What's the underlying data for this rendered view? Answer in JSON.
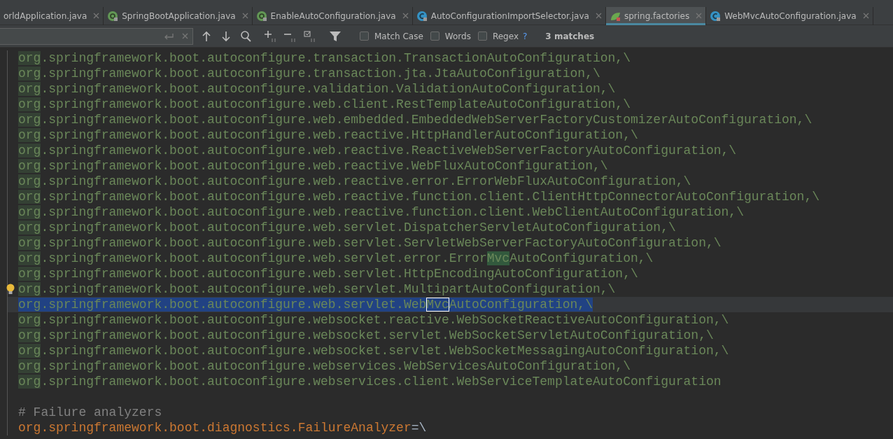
{
  "tabs": [
    {
      "label": "orldApplication.java",
      "kind": "plain",
      "selected": false
    },
    {
      "label": "SpringBootApplication.java",
      "kind": "annotation",
      "selected": false
    },
    {
      "label": "EnableAutoConfiguration.java",
      "kind": "annotation",
      "selected": false
    },
    {
      "label": "AutoConfigurationImportSelector.java",
      "kind": "class",
      "selected": false
    },
    {
      "label": "spring.factories",
      "kind": "factories",
      "selected": true
    },
    {
      "label": "WebMvcAutoConfiguration.java",
      "kind": "class",
      "selected": false
    }
  ],
  "search": {
    "match_case": {
      "label": "Match Case",
      "checked": false
    },
    "words": {
      "label": "Words",
      "checked": false
    },
    "regex": {
      "label": "Regex",
      "checked": false
    },
    "help": "?",
    "result": "3 matches"
  },
  "lines": [
    {
      "bulb": false,
      "selected": false,
      "segments": [
        {
          "kind": "org",
          "text": "org"
        },
        {
          "kind": "value",
          "text": ".springframework.boot.autoconfigure.transaction.TransactionAutoConfiguration,\\"
        }
      ]
    },
    {
      "bulb": false,
      "selected": false,
      "segments": [
        {
          "kind": "org",
          "text": "org"
        },
        {
          "kind": "value",
          "text": ".springframework.boot.autoconfigure.transaction.jta.JtaAutoConfiguration,\\"
        }
      ]
    },
    {
      "bulb": false,
      "selected": false,
      "segments": [
        {
          "kind": "org",
          "text": "org"
        },
        {
          "kind": "value",
          "text": ".springframework.boot.autoconfigure.validation.ValidationAutoConfiguration,\\"
        }
      ]
    },
    {
      "bulb": false,
      "selected": false,
      "segments": [
        {
          "kind": "org",
          "text": "org"
        },
        {
          "kind": "value",
          "text": ".springframework.boot.autoconfigure.web.client.RestTemplateAutoConfiguration,\\"
        }
      ]
    },
    {
      "bulb": false,
      "selected": false,
      "segments": [
        {
          "kind": "org",
          "text": "org"
        },
        {
          "kind": "value",
          "text": ".springframework.boot.autoconfigure.web.embedded.EmbeddedWebServerFactoryCustomizerAutoConfiguration,\\"
        }
      ]
    },
    {
      "bulb": false,
      "selected": false,
      "segments": [
        {
          "kind": "org",
          "text": "org"
        },
        {
          "kind": "value",
          "text": ".springframework.boot.autoconfigure.web.reactive.HttpHandlerAutoConfiguration,\\"
        }
      ]
    },
    {
      "bulb": false,
      "selected": false,
      "segments": [
        {
          "kind": "org",
          "text": "org"
        },
        {
          "kind": "value",
          "text": ".springframework.boot.autoconfigure.web.reactive.ReactiveWebServerFactoryAutoConfiguration,\\"
        }
      ]
    },
    {
      "bulb": false,
      "selected": false,
      "segments": [
        {
          "kind": "org",
          "text": "org"
        },
        {
          "kind": "value",
          "text": ".springframework.boot.autoconfigure.web.reactive.WebFluxAutoConfiguration,\\"
        }
      ]
    },
    {
      "bulb": false,
      "selected": false,
      "segments": [
        {
          "kind": "org",
          "text": "org"
        },
        {
          "kind": "value",
          "text": ".springframework.boot.autoconfigure.web.reactive.error.ErrorWebFluxAutoConfiguration,\\"
        }
      ]
    },
    {
      "bulb": false,
      "selected": false,
      "segments": [
        {
          "kind": "org",
          "text": "org"
        },
        {
          "kind": "value",
          "text": ".springframework.boot.autoconfigure.web.reactive.function.client.ClientHttpConnectorAutoConfiguration,\\"
        }
      ]
    },
    {
      "bulb": false,
      "selected": false,
      "segments": [
        {
          "kind": "org",
          "text": "org"
        },
        {
          "kind": "value",
          "text": ".springframework.boot.autoconfigure.web.reactive.function.client.WebClientAutoConfiguration,\\"
        }
      ]
    },
    {
      "bulb": false,
      "selected": false,
      "segments": [
        {
          "kind": "org",
          "text": "org"
        },
        {
          "kind": "value",
          "text": ".springframework.boot.autoconfigure.web.servlet.DispatcherServletAutoConfiguration,\\"
        }
      ]
    },
    {
      "bulb": false,
      "selected": false,
      "segments": [
        {
          "kind": "org",
          "text": "org"
        },
        {
          "kind": "value",
          "text": ".springframework.boot.autoconfigure.web.servlet.ServletWebServerFactoryAutoConfiguration,\\"
        }
      ]
    },
    {
      "bulb": false,
      "selected": false,
      "segments": [
        {
          "kind": "org",
          "text": "org"
        },
        {
          "kind": "value",
          "text": ".springframework.boot.autoconfigure.web.servlet.error.Error"
        },
        {
          "kind": "match",
          "text": "Mvc"
        },
        {
          "kind": "value",
          "text": "AutoConfiguration,\\"
        }
      ]
    },
    {
      "bulb": false,
      "selected": false,
      "segments": [
        {
          "kind": "org",
          "text": "org"
        },
        {
          "kind": "value",
          "text": ".springframework.boot.autoconfigure.web.servlet.HttpEncodingAutoConfiguration,\\"
        }
      ]
    },
    {
      "bulb": true,
      "selected": false,
      "segments": [
        {
          "kind": "org",
          "text": "org"
        },
        {
          "kind": "value",
          "text": ".springframework.boot.autoconfigure.web.servlet.MultipartAutoConfiguration,\\"
        }
      ]
    },
    {
      "bulb": false,
      "selected": true,
      "segments": [
        {
          "kind": "value",
          "text": "org.springframework.boot.autoconfigure.web.servlet.Web"
        },
        {
          "kind": "current",
          "text": "Mvc"
        },
        {
          "kind": "value",
          "text": "AutoConfiguration,\\"
        }
      ]
    },
    {
      "bulb": false,
      "selected": false,
      "segments": [
        {
          "kind": "org",
          "text": "org"
        },
        {
          "kind": "value",
          "text": ".springframework.boot.autoconfigure.websocket.reactive.WebSocketReactiveAutoConfiguration,\\"
        }
      ]
    },
    {
      "bulb": false,
      "selected": false,
      "segments": [
        {
          "kind": "org",
          "text": "org"
        },
        {
          "kind": "value",
          "text": ".springframework.boot.autoconfigure.websocket.servlet.WebSocketServletAutoConfiguration,\\"
        }
      ]
    },
    {
      "bulb": false,
      "selected": false,
      "segments": [
        {
          "kind": "org",
          "text": "org"
        },
        {
          "kind": "value",
          "text": ".springframework.boot.autoconfigure.websocket.servlet.WebSocketMessagingAutoConfiguration,\\"
        }
      ]
    },
    {
      "bulb": false,
      "selected": false,
      "segments": [
        {
          "kind": "org",
          "text": "org"
        },
        {
          "kind": "value",
          "text": ".springframework.boot.autoconfigure.webservices.WebServicesAutoConfiguration,\\"
        }
      ]
    },
    {
      "bulb": false,
      "selected": false,
      "segments": [
        {
          "kind": "org",
          "text": "org"
        },
        {
          "kind": "value",
          "text": ".springframework.boot.autoconfigure.webservices.client.WebServiceTemplateAutoConfiguration"
        }
      ]
    },
    {
      "bulb": false,
      "selected": false
    },
    {
      "bulb": false,
      "selected": false,
      "segments": [
        {
          "kind": "comment",
          "text": "# Failure analyzers"
        }
      ]
    },
    {
      "bulb": false,
      "selected": false,
      "segments": [
        {
          "kind": "key",
          "text": "org.springframework.boot.diagnostics.FailureAnalyzer"
        },
        {
          "kind": "sep",
          "text": "=\\"
        }
      ]
    }
  ]
}
